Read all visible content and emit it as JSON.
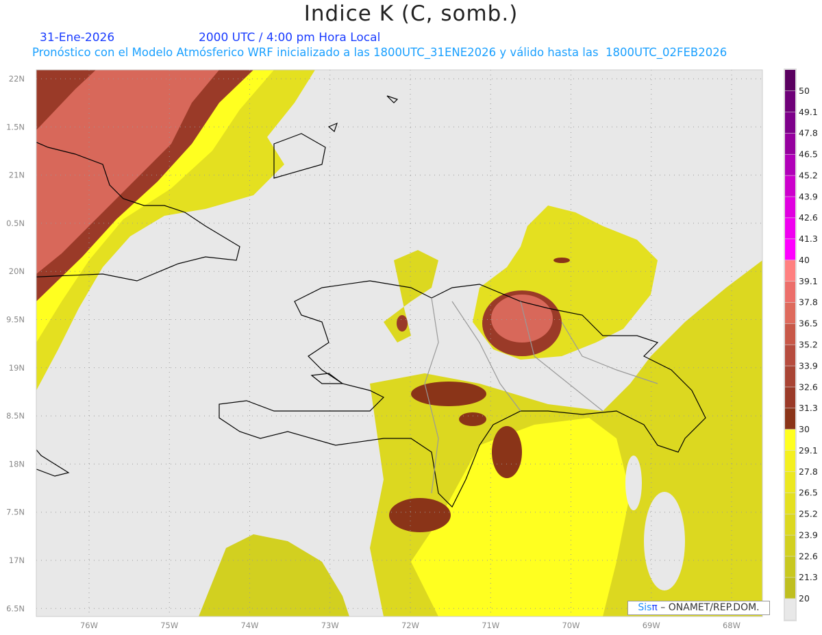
{
  "header": {
    "title": "Indice K (C, somb.)",
    "date": "31-Ene-2026",
    "time": "2000 UTC / 4:00 pm Hora Local",
    "subtitle": "Pronóstico con el Modelo Atmósferico WRF inicializado a las 1800UTC_31ENE2026 y válido hasta las  1800UTC_02FEB2026"
  },
  "map": {
    "lon_labels": [
      "76W",
      "75W",
      "74W",
      "73W",
      "72W",
      "71W",
      "70W",
      "69W",
      "68W"
    ],
    "lat_labels": [
      "22N",
      "1.5N",
      "21N",
      "0.5N",
      "20N",
      "9.5N",
      "19N",
      "8.5N",
      "18N",
      "7.5N",
      "17N",
      "6.5N"
    ],
    "background_color": "#e8e8e8"
  },
  "colorbar": {
    "labels": [
      "50",
      "49.1",
      "47.8",
      "46.5",
      "45.2",
      "43.9",
      "42.6",
      "41.3",
      "40",
      "39.1",
      "37.8",
      "36.5",
      "35.2",
      "33.9",
      "32.6",
      "31.3",
      "30",
      "29.1",
      "27.8",
      "26.5",
      "25.2",
      "23.9",
      "22.6",
      "21.3",
      "20"
    ],
    "colors": [
      "#5a0060",
      "#6e0078",
      "#7d008a",
      "#95009e",
      "#b000b8",
      "#cc00cc",
      "#e000e0",
      "#f000f0",
      "#ff00ff",
      "#ff8080",
      "#ec6e6a",
      "#de6a5c",
      "#c85848",
      "#b64c3e",
      "#a84434",
      "#9a3a28",
      "#8a3418",
      "#ffff20",
      "#f4f020",
      "#ece820",
      "#e4e020",
      "#dcd820",
      "#d2d020",
      "#c8c820",
      "#bfbf20",
      "#e8e8e8"
    ]
  },
  "watermark": {
    "sis": "Sis",
    "pi": "π",
    "text": " – ONAMET/REP.DOM."
  }
}
